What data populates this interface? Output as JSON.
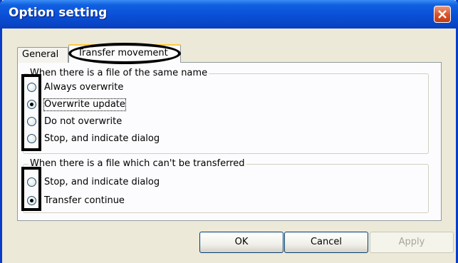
{
  "window": {
    "title": "Option setting",
    "close_icon": "close-x-icon"
  },
  "tabs": [
    {
      "label": "General",
      "selected": false
    },
    {
      "label": "Transfer movement",
      "selected": true
    }
  ],
  "same_name_group": {
    "legend": "When there is a file of the same name",
    "options": [
      {
        "label": "Always overwrite",
        "checked": false
      },
      {
        "label": "Overwrite update",
        "checked": true
      },
      {
        "label": "Do not overwrite",
        "checked": false
      },
      {
        "label": "Stop, and indicate dialog",
        "checked": false
      }
    ]
  },
  "cant_transfer_group": {
    "legend": "When there is a file which can't be transferred",
    "options": [
      {
        "label": "Stop, and indicate dialog",
        "checked": false
      },
      {
        "label": "Transfer continue",
        "checked": true
      }
    ]
  },
  "buttons": {
    "ok": "OK",
    "cancel": "Cancel",
    "apply": "Apply"
  },
  "colors": {
    "title_bar": "#0a4fd8",
    "dialog_bg": "#ece9d8",
    "close_button": "#d8562e",
    "highlight": "#000000"
  }
}
